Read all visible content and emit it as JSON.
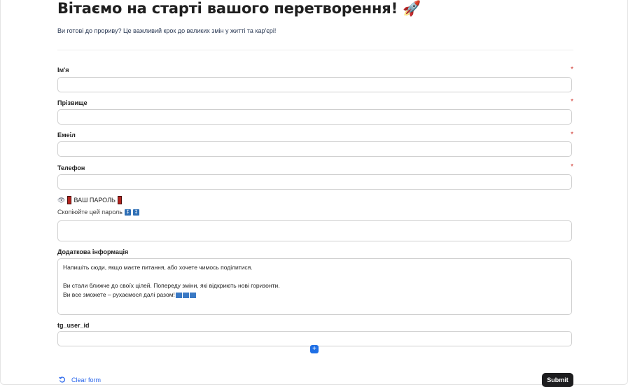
{
  "header": {
    "title": "Вітаємо на старті вашого перетворення! 🚀",
    "subtitle": "Ви готові до прориву? Це важливий крок до великих змін у житті та кар'єрі!"
  },
  "fields": {
    "first_name": {
      "label": "Ім'я",
      "required_mark": "*",
      "value": ""
    },
    "last_name": {
      "label": "Прізвище",
      "required_mark": "*",
      "value": ""
    },
    "email": {
      "label": "Емеіл",
      "required_mark": "*",
      "value": ""
    },
    "phone": {
      "label": "Телефон",
      "required_mark": "*",
      "value": ""
    },
    "password": {
      "label": "ВАШ ПАРОЛЬ",
      "hint": "Скопіюйте цей пароль",
      "value": ""
    },
    "extra_info": {
      "label": "Додаткова інформація",
      "lines": [
        "Напишіть сюди, якщо маєте питання, або хочете чимось поділитися.",
        "",
        "Ви стали ближче до своїх цілей. Попереду зміни, які відкриють нові горизонти.",
        "Ви все зможете – рухаємося далі разом!"
      ]
    },
    "tg_user_id": {
      "label": "tg_user_id",
      "value": ""
    }
  },
  "actions": {
    "clear_label": "Clear form",
    "submit_label": "Submit",
    "add_label": "+"
  },
  "icons": {
    "eye": "eye-icon",
    "arrow_down": "arrow-down-icon",
    "refresh": "refresh-icon"
  },
  "colors": {
    "accent": "#2563eb",
    "required": "#d0342c",
    "submit_bg": "#1d1d1f"
  }
}
